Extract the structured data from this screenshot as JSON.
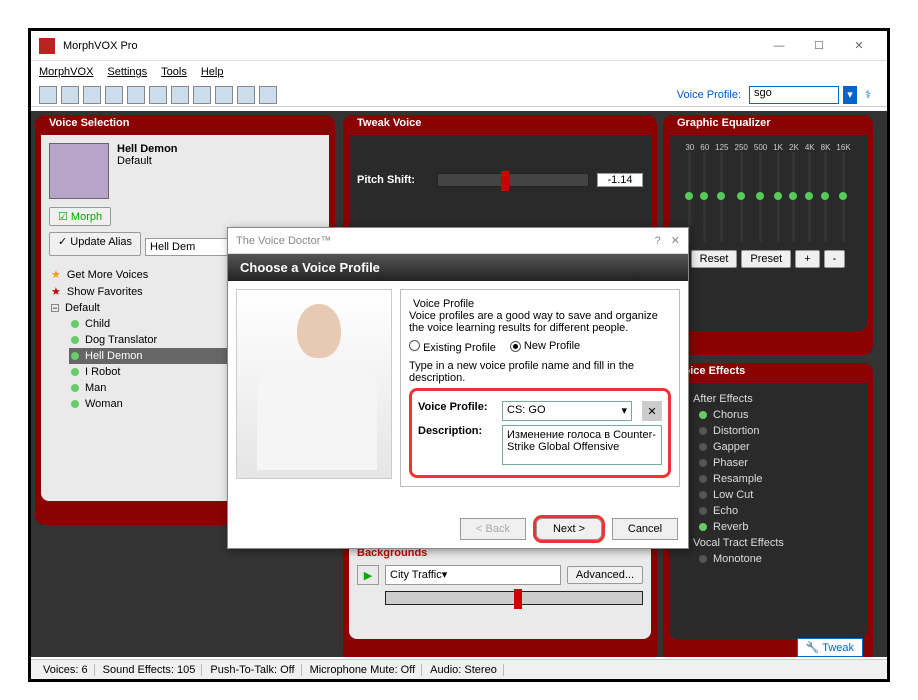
{
  "window": {
    "title": "MorphVOX Pro"
  },
  "menu": {
    "morphvox": "MorphVOX",
    "settings": "Settings",
    "tools": "Tools",
    "help": "Help"
  },
  "voice_profile_bar": {
    "label": "Voice Profile:",
    "value": "sgo"
  },
  "panels": {
    "voice_selection": {
      "title": "Voice Selection",
      "current_name": "Hell Demon",
      "current_sub": "Default",
      "morph_btn": "Morph",
      "update_alias": "Update Alias",
      "alias_value": "Hell Dem",
      "tree": {
        "get_more": "Get More Voices",
        "show_fav": "Show Favorites",
        "default": "Default",
        "items": [
          "Child",
          "Dog Translator",
          "Hell Demon",
          "I Robot",
          "Man",
          "Woman"
        ]
      }
    },
    "tweak": {
      "title": "Tweak Voice",
      "pitch_label": "Pitch Shift:",
      "pitch_value": "-1.14"
    },
    "eq": {
      "title": "Graphic Equalizer",
      "bands": [
        "30",
        "60",
        "125",
        "250",
        "500",
        "1K",
        "2K",
        "4K",
        "8K",
        "16K"
      ],
      "reset": "Reset",
      "preset": "Preset",
      "plus": "+",
      "minus": "-"
    },
    "sounds": {
      "backgrounds": "Backgrounds",
      "bg_value": "City Traffic",
      "advanced": "Advanced..."
    },
    "effects": {
      "title": "Voice Effects",
      "after": "After Effects",
      "items": [
        "Chorus",
        "Distortion",
        "Gapper",
        "Phaser",
        "Resample",
        "Low Cut",
        "Echo",
        "Reverb"
      ],
      "vocal": "Vocal Tract Effects",
      "vocal_items": [
        "Monotone"
      ],
      "tweak_btn": "Tweak"
    }
  },
  "dialog": {
    "title": "The Voice Doctor™",
    "heading": "Choose a Voice Profile",
    "section": "Voice Profile",
    "intro": "Voice profiles are a good way to save and organize the voice learning results for different people.",
    "existing": "Existing Profile",
    "new": "New Profile",
    "type_hint": "Type in a new voice profile name and fill in the description.",
    "vp_label": "Voice Profile:",
    "vp_value": "CS: GO",
    "desc_label": "Description:",
    "desc_value": "Изменение голоса в Counter-Strike Global Offensive",
    "back": "< Back",
    "next": "Next >",
    "cancel": "Cancel"
  },
  "status": {
    "voices": "Voices: 6",
    "sfx": "Sound Effects: 105",
    "ptt": "Push-To-Talk: Off",
    "mic": "Microphone Mute: Off",
    "audio": "Audio: Stereo"
  }
}
